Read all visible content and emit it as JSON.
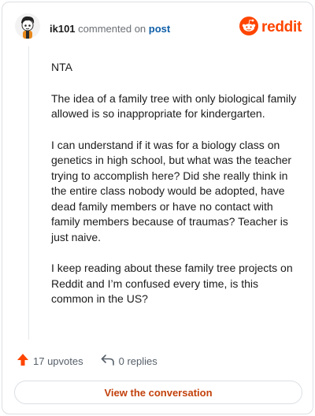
{
  "header": {
    "username": "ik101",
    "commented_text": "commented on",
    "post_link": "post",
    "avatar_icon": "snoo-avatar-icon"
  },
  "brand": {
    "wordmark": "reddit",
    "logo_icon": "reddit-snoo-icon",
    "color": "#ff4500"
  },
  "comment": {
    "paragraphs": [
      "NTA",
      "The idea of a family tree with only biological family allowed is so inappropriate for kindergarten.",
      "I can understand if it was for a biology class on genetics in high school, but what was the teacher trying to accomplish here? Did she really think in the entire class nobody would be adopted, have dead family members or have no contact with family members because of traumas? Teacher is just naive.",
      "I keep reading about these family tree projects on Reddit and I’m confused every time, is this common in the US?"
    ]
  },
  "actions": {
    "upvotes_label": "17 upvotes",
    "upvote_icon": "upvote-arrow-icon",
    "upvote_color": "#ff4500",
    "replies_label": "0 replies",
    "reply_icon": "reply-arrow-icon"
  },
  "footer": {
    "view_conversation_label": "View the conversation"
  }
}
